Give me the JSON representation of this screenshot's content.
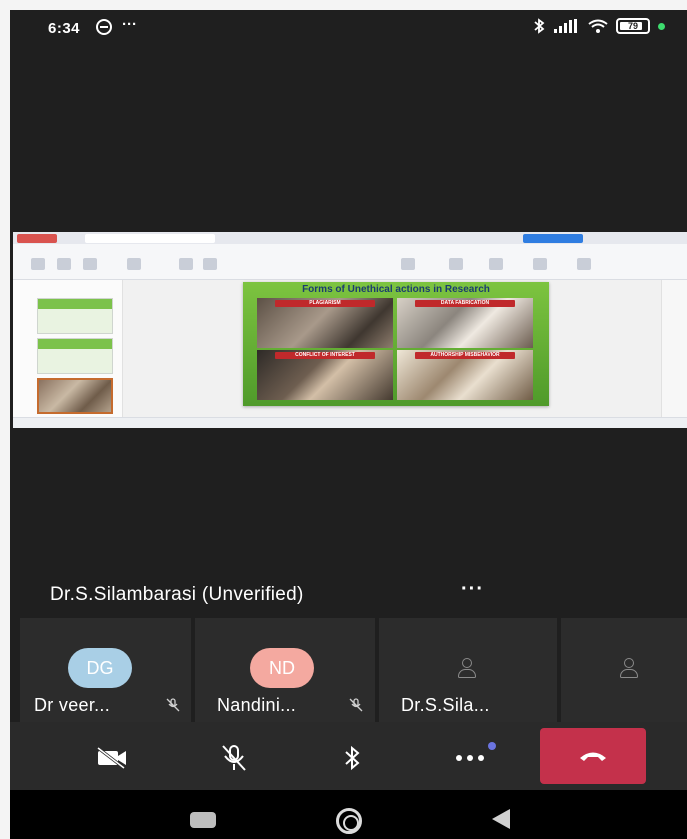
{
  "status_bar": {
    "time": "6:34",
    "more": "···",
    "battery": "79"
  },
  "shared_screen": {
    "slide_title": "Forms of Unethical actions in Research",
    "panels": [
      "PLAGIARISM",
      "DATA FABRICATION",
      "CONFLICT OF INTEREST",
      "AUTHORSHIP MISBEHAVIOR"
    ]
  },
  "speaker": {
    "name": "Dr.S.Silambarasi (Unverified)",
    "more": "···"
  },
  "participants": [
    {
      "initials": "DG",
      "name": "Dr veer...",
      "avatar_color": "#a9cfe6",
      "muted": true
    },
    {
      "initials": "ND",
      "name": "Nandini...",
      "avatar_color": "#f4a9a0",
      "muted": true
    },
    {
      "initials": "",
      "name": "Dr.S.Sila...",
      "muted": false
    },
    {
      "initials": "",
      "name": "",
      "muted": false
    }
  ],
  "controls": {
    "video_icon": "video-off-icon",
    "mic_icon": "mic-off-icon",
    "bluetooth_icon": "bluetooth-icon",
    "more_icon": "more-icon",
    "hangup_icon": "phone-hangup-icon",
    "hangup_color": "#c4314b"
  },
  "nav_bar": {
    "recent_icon": "recent-apps-icon",
    "home_icon": "home-icon",
    "back_icon": "back-icon"
  }
}
